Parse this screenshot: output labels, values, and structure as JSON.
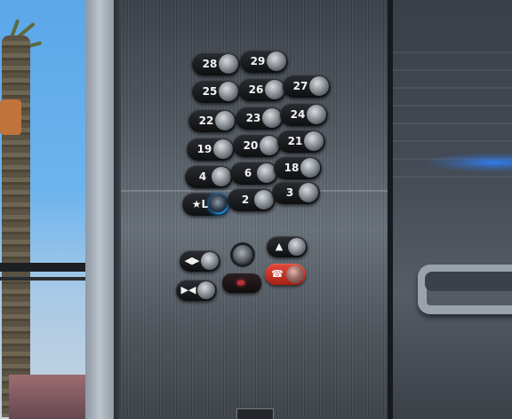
{
  "floor_buttons": [
    {
      "label": "28",
      "lit": false
    },
    {
      "label": "29",
      "lit": false
    },
    {
      "label": "25",
      "lit": false
    },
    {
      "label": "26",
      "lit": false
    },
    {
      "label": "27",
      "lit": false
    },
    {
      "label": "22",
      "lit": false
    },
    {
      "label": "23",
      "lit": false
    },
    {
      "label": "24",
      "lit": false
    },
    {
      "label": "19",
      "lit": false
    },
    {
      "label": "20",
      "lit": false
    },
    {
      "label": "21",
      "lit": false
    },
    {
      "label": "4",
      "lit": false
    },
    {
      "label": "6",
      "lit": false
    },
    {
      "label": "18",
      "lit": false
    },
    {
      "label": "★L",
      "lit": true
    },
    {
      "label": "2",
      "lit": false
    },
    {
      "label": "3",
      "lit": false
    }
  ],
  "control_buttons": [
    {
      "label": "◀▶",
      "name": "door-open-button"
    },
    {
      "label": "▲",
      "name": "alarm-bell-button"
    },
    {
      "label": "▶◀",
      "name": "door-close-button"
    },
    {
      "label": "☎",
      "name": "emergency-call-button"
    }
  ],
  "colors": {
    "lit_ring": "#1fa3ff",
    "emergency_red": "#d63a2c",
    "display_led": "#b7333a"
  }
}
